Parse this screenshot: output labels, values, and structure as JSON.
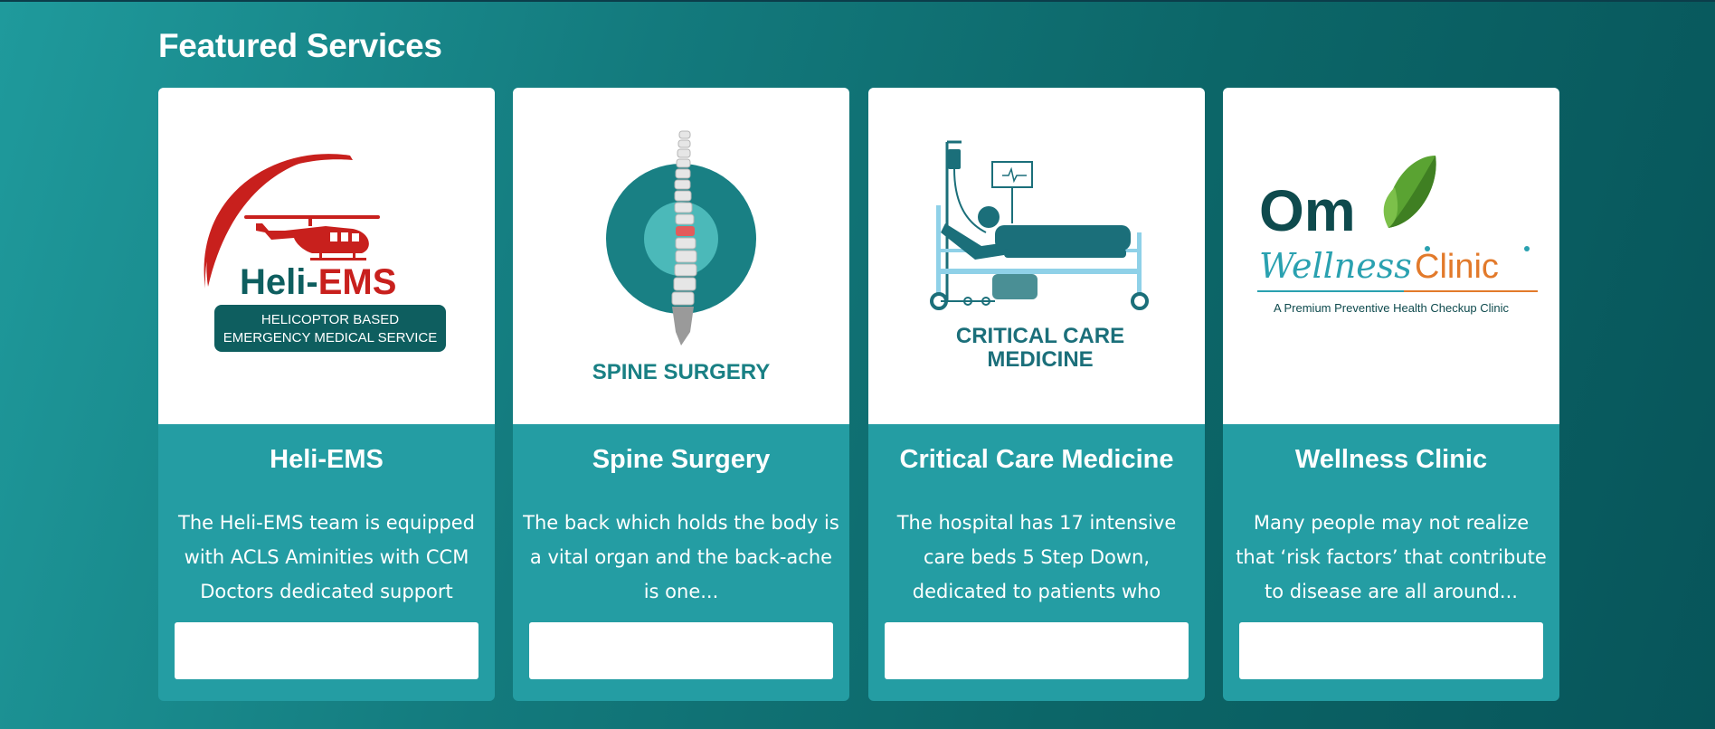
{
  "section": {
    "title": "Featured Services"
  },
  "colors": {
    "teal_dark": "#0e6a6e",
    "card_teal": "#249da3",
    "heli_red": "#c8201d",
    "wellness_orange": "#e27a2b",
    "wellness_green": "#5aa332"
  },
  "cards": [
    {
      "title": "Heli-EMS",
      "description": "The Heli-EMS team is equipped with ACLS Aminities with CCM Doctors dedicated support during the...",
      "button_label": "",
      "logo": {
        "icon": "helicopter-icon",
        "brand_left": "Heli-",
        "brand_right": "EMS",
        "tag_line1": "HELICOPTOR BASED",
        "tag_line2": "EMERGENCY MEDICAL SERVICE"
      }
    },
    {
      "title": "Spine Surgery",
      "description": "The back which holds the body is a vital organ and the back-ache is one...",
      "button_label": "",
      "logo": {
        "icon": "spine-icon",
        "label": "SPINE SURGERY"
      }
    },
    {
      "title": "Critical Care Medicine",
      "description": "The hospital has 17 intensive care beds 5 Step Down, dedicated to patients who need...",
      "button_label": "",
      "logo": {
        "icon": "hospital-bed-icon",
        "label_line1": "CRITICAL CARE",
        "label_line2": "MEDICINE"
      }
    },
    {
      "title": "Wellness Clinic",
      "description": "Many people may not realize that ‘risk factors’ that contribute to disease are all around...",
      "button_label": "",
      "logo": {
        "icon": "leaf-icon",
        "brand_top": "Om",
        "brand_script": "Wellness",
        "brand_clinic": "Clinic",
        "tagline": "A Premium Preventive Health Checkup Clinic"
      }
    }
  ]
}
